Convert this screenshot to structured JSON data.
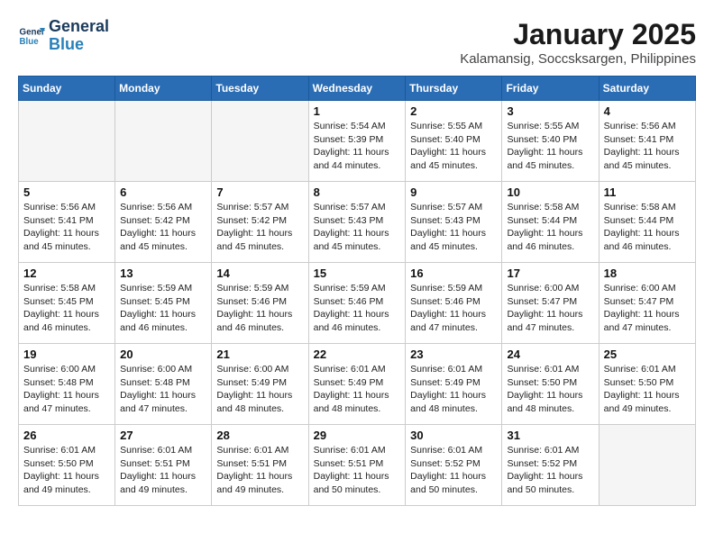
{
  "logo": {
    "line1": "General",
    "line2": "Blue"
  },
  "title": "January 2025",
  "subtitle": "Kalamansig, Soccsksargen, Philippines",
  "days_of_week": [
    "Sunday",
    "Monday",
    "Tuesday",
    "Wednesday",
    "Thursday",
    "Friday",
    "Saturday"
  ],
  "weeks": [
    [
      {
        "num": "",
        "info": ""
      },
      {
        "num": "",
        "info": ""
      },
      {
        "num": "",
        "info": ""
      },
      {
        "num": "1",
        "info": "Sunrise: 5:54 AM\nSunset: 5:39 PM\nDaylight: 11 hours\nand 44 minutes."
      },
      {
        "num": "2",
        "info": "Sunrise: 5:55 AM\nSunset: 5:40 PM\nDaylight: 11 hours\nand 45 minutes."
      },
      {
        "num": "3",
        "info": "Sunrise: 5:55 AM\nSunset: 5:40 PM\nDaylight: 11 hours\nand 45 minutes."
      },
      {
        "num": "4",
        "info": "Sunrise: 5:56 AM\nSunset: 5:41 PM\nDaylight: 11 hours\nand 45 minutes."
      }
    ],
    [
      {
        "num": "5",
        "info": "Sunrise: 5:56 AM\nSunset: 5:41 PM\nDaylight: 11 hours\nand 45 minutes."
      },
      {
        "num": "6",
        "info": "Sunrise: 5:56 AM\nSunset: 5:42 PM\nDaylight: 11 hours\nand 45 minutes."
      },
      {
        "num": "7",
        "info": "Sunrise: 5:57 AM\nSunset: 5:42 PM\nDaylight: 11 hours\nand 45 minutes."
      },
      {
        "num": "8",
        "info": "Sunrise: 5:57 AM\nSunset: 5:43 PM\nDaylight: 11 hours\nand 45 minutes."
      },
      {
        "num": "9",
        "info": "Sunrise: 5:57 AM\nSunset: 5:43 PM\nDaylight: 11 hours\nand 45 minutes."
      },
      {
        "num": "10",
        "info": "Sunrise: 5:58 AM\nSunset: 5:44 PM\nDaylight: 11 hours\nand 46 minutes."
      },
      {
        "num": "11",
        "info": "Sunrise: 5:58 AM\nSunset: 5:44 PM\nDaylight: 11 hours\nand 46 minutes."
      }
    ],
    [
      {
        "num": "12",
        "info": "Sunrise: 5:58 AM\nSunset: 5:45 PM\nDaylight: 11 hours\nand 46 minutes."
      },
      {
        "num": "13",
        "info": "Sunrise: 5:59 AM\nSunset: 5:45 PM\nDaylight: 11 hours\nand 46 minutes."
      },
      {
        "num": "14",
        "info": "Sunrise: 5:59 AM\nSunset: 5:46 PM\nDaylight: 11 hours\nand 46 minutes."
      },
      {
        "num": "15",
        "info": "Sunrise: 5:59 AM\nSunset: 5:46 PM\nDaylight: 11 hours\nand 46 minutes."
      },
      {
        "num": "16",
        "info": "Sunrise: 5:59 AM\nSunset: 5:46 PM\nDaylight: 11 hours\nand 47 minutes."
      },
      {
        "num": "17",
        "info": "Sunrise: 6:00 AM\nSunset: 5:47 PM\nDaylight: 11 hours\nand 47 minutes."
      },
      {
        "num": "18",
        "info": "Sunrise: 6:00 AM\nSunset: 5:47 PM\nDaylight: 11 hours\nand 47 minutes."
      }
    ],
    [
      {
        "num": "19",
        "info": "Sunrise: 6:00 AM\nSunset: 5:48 PM\nDaylight: 11 hours\nand 47 minutes."
      },
      {
        "num": "20",
        "info": "Sunrise: 6:00 AM\nSunset: 5:48 PM\nDaylight: 11 hours\nand 47 minutes."
      },
      {
        "num": "21",
        "info": "Sunrise: 6:00 AM\nSunset: 5:49 PM\nDaylight: 11 hours\nand 48 minutes."
      },
      {
        "num": "22",
        "info": "Sunrise: 6:01 AM\nSunset: 5:49 PM\nDaylight: 11 hours\nand 48 minutes."
      },
      {
        "num": "23",
        "info": "Sunrise: 6:01 AM\nSunset: 5:49 PM\nDaylight: 11 hours\nand 48 minutes."
      },
      {
        "num": "24",
        "info": "Sunrise: 6:01 AM\nSunset: 5:50 PM\nDaylight: 11 hours\nand 48 minutes."
      },
      {
        "num": "25",
        "info": "Sunrise: 6:01 AM\nSunset: 5:50 PM\nDaylight: 11 hours\nand 49 minutes."
      }
    ],
    [
      {
        "num": "26",
        "info": "Sunrise: 6:01 AM\nSunset: 5:50 PM\nDaylight: 11 hours\nand 49 minutes."
      },
      {
        "num": "27",
        "info": "Sunrise: 6:01 AM\nSunset: 5:51 PM\nDaylight: 11 hours\nand 49 minutes."
      },
      {
        "num": "28",
        "info": "Sunrise: 6:01 AM\nSunset: 5:51 PM\nDaylight: 11 hours\nand 49 minutes."
      },
      {
        "num": "29",
        "info": "Sunrise: 6:01 AM\nSunset: 5:51 PM\nDaylight: 11 hours\nand 50 minutes."
      },
      {
        "num": "30",
        "info": "Sunrise: 6:01 AM\nSunset: 5:52 PM\nDaylight: 11 hours\nand 50 minutes."
      },
      {
        "num": "31",
        "info": "Sunrise: 6:01 AM\nSunset: 5:52 PM\nDaylight: 11 hours\nand 50 minutes."
      },
      {
        "num": "",
        "info": ""
      }
    ]
  ]
}
